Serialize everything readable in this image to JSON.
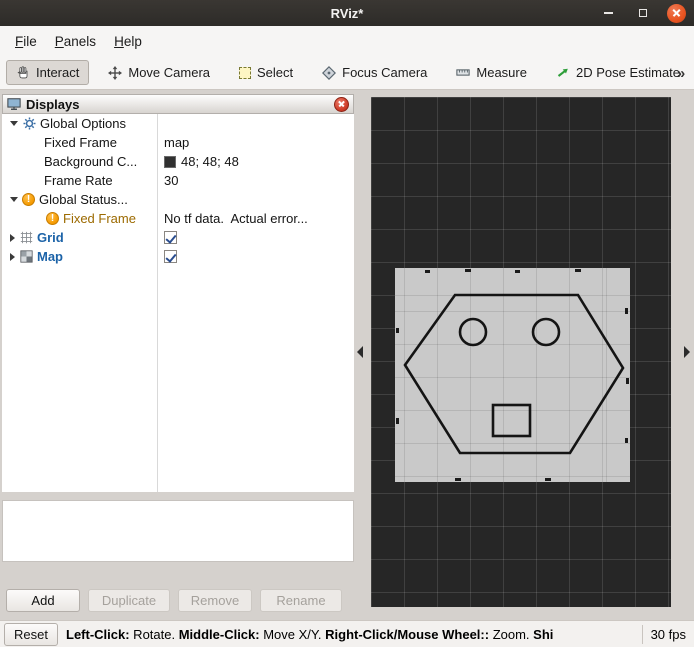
{
  "window": {
    "title": "RViz*"
  },
  "menu": {
    "items": [
      {
        "label": "File"
      },
      {
        "label": "Panels"
      },
      {
        "label": "Help"
      }
    ]
  },
  "toolbar": {
    "buttons": [
      {
        "label": "Interact",
        "active": true
      },
      {
        "label": "Move Camera",
        "active": false
      },
      {
        "label": "Select",
        "active": false
      },
      {
        "label": "Focus Camera",
        "active": false
      },
      {
        "label": "Measure",
        "active": false
      },
      {
        "label": "2D Pose Estimate",
        "active": false
      }
    ],
    "overflow_label": "»"
  },
  "displays": {
    "title": "Displays",
    "rows": [
      {
        "name": "Global Options",
        "value": ""
      },
      {
        "name": "Fixed Frame",
        "value": "map"
      },
      {
        "name": "Background C...",
        "value": "48; 48; 48",
        "swatch": "#303030"
      },
      {
        "name": "Frame Rate",
        "value": "30"
      },
      {
        "name": "Global Status...",
        "value": ""
      },
      {
        "name": "Fixed Frame",
        "value": "No tf data.  Actual error..."
      },
      {
        "name": "Grid",
        "checked": true
      },
      {
        "name": "Map",
        "checked": true
      }
    ],
    "buttons": [
      {
        "label": "Add",
        "enabled": true
      },
      {
        "label": "Duplicate",
        "enabled": false
      },
      {
        "label": "Remove",
        "enabled": false
      },
      {
        "label": "Rename",
        "enabled": false
      }
    ]
  },
  "statusbar": {
    "reset_label": "Reset",
    "hints": [
      {
        "key": "Left-Click:",
        "action": " Rotate. "
      },
      {
        "key": "Middle-Click:",
        "action": " Move X/Y. "
      },
      {
        "key": "Right-Click/Mouse Wheel::",
        "action": " Zoom. "
      },
      {
        "key": "Shi",
        "action": ""
      }
    ],
    "fps": "30 fps"
  },
  "colors": {
    "close_button": "#E95420",
    "viewport_background": "#303030",
    "map_background": "#c9c9c9",
    "display_name_blue": "#1c63a8",
    "warning_orange": "#f59a00"
  }
}
